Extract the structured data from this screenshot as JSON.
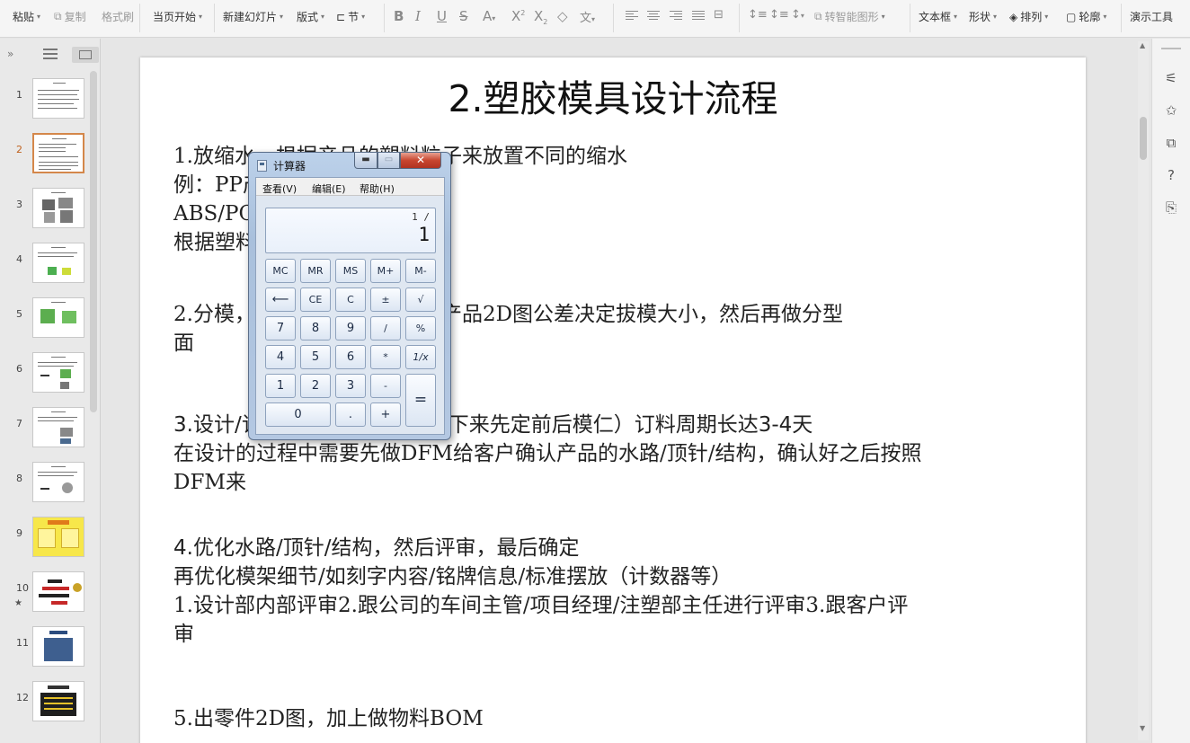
{
  "ribbon": {
    "paste": "粘贴",
    "copy": "复制",
    "format_painter": "格式刷",
    "from_current": "当页开始",
    "new_slide": "新建幻灯片",
    "layout": "版式",
    "section": "节",
    "smart_shape": "转智能图形",
    "textbox": "文本框",
    "shape": "形状",
    "arrange": "排列",
    "outline": "轮廓",
    "present_tools": "演示工具",
    "wen_glyph": "文"
  },
  "thumbnails": [
    {
      "num": "1"
    },
    {
      "num": "2"
    },
    {
      "num": "3"
    },
    {
      "num": "4"
    },
    {
      "num": "5"
    },
    {
      "num": "6"
    },
    {
      "num": "7"
    },
    {
      "num": "8"
    },
    {
      "num": "9"
    },
    {
      "num": "10"
    },
    {
      "num": "11"
    },
    {
      "num": "12"
    }
  ],
  "active_slide": 2,
  "slide": {
    "title": "2.塑胶模具设计流程",
    "lines": [
      "1.放缩水，根据产品的塑料粒子来放置不同的缩水",
      "例：PP产品一般缩水1.018",
      "ABS/PC产品一般缩水1.005",
      "根据塑料",
      " 2.分模，把产品摆正然后根据产品2D图公差决定拔模大小，然后再做分型",
      " 面",
      "3.设计/订购模架，模架（确定下来先定前后模仁）订料周期长达3-4天",
      "在设计的过程中需要先做DFM给客户确认产品的水路/顶针/结构，确认好之后按照",
      "DFM来",
      "4.优化水路/顶针/结构，然后评审，最后确定",
      "再优化模架细节/如刻字内容/铭牌信息/标准摆放（计数器等）",
      "1.设计部内部评审2.跟公司的车间主管/项目经理/注塑部主任进行评审3.跟客户评",
      "审",
      "5.出零件2D图，加上做物料BOM"
    ]
  },
  "calculator": {
    "title": "计算器",
    "menu": {
      "view": "查看(V)",
      "edit": "编辑(E)",
      "help": "帮助(H)"
    },
    "display_memo": "1 /",
    "display_value": "1",
    "buttons": {
      "mc": "MC",
      "mr": "MR",
      "ms": "MS",
      "mplus": "M+",
      "mminus": "M-",
      "back": "⟵",
      "ce": "CE",
      "c": "C",
      "pm": "±",
      "sqrt": "√",
      "seven": "7",
      "eight": "8",
      "nine": "9",
      "div": "/",
      "pct": "%",
      "four": "4",
      "five": "5",
      "six": "6",
      "mul": "*",
      "recip": "1/x",
      "one": "1",
      "two": "2",
      "three": "3",
      "minus": "-",
      "eq": "=",
      "zero": "0",
      "dot": ".",
      "plus": "+"
    }
  }
}
